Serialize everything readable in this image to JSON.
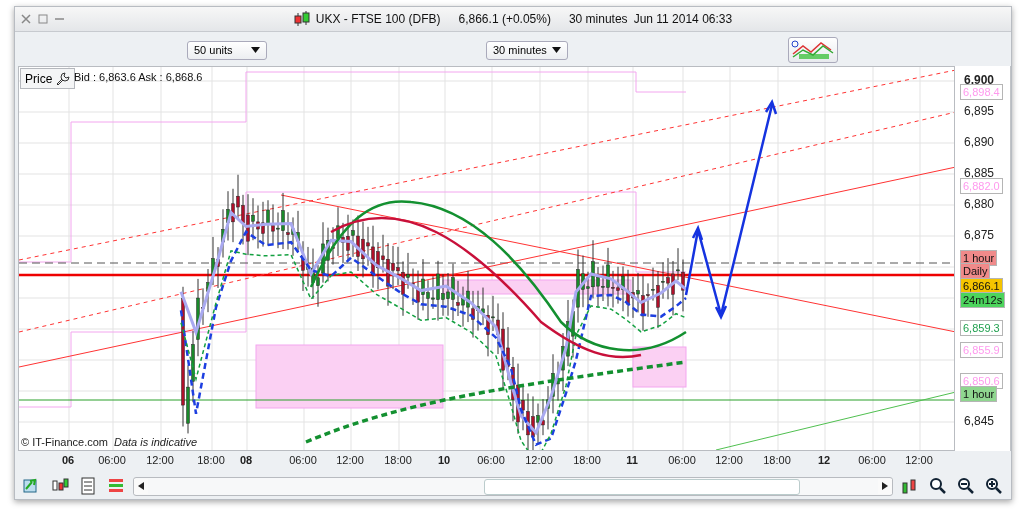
{
  "window": {
    "title": "UKX - FTSE 100 (DFB)",
    "quote": "6,866.1 (+0.05%)",
    "interval": "30 minutes",
    "timestamp": "Jun 11 2014 06:33"
  },
  "toolbar": {
    "size_select": "50 units",
    "interval_select": "30 minutes"
  },
  "chart": {
    "price_button": "Price",
    "bid_ask": "Bid : 6,863.6 Ask : 6,868.6",
    "copyright": "© IT-Finance.com",
    "disclaimer": "Data is indicative",
    "y_ticks": [
      {
        "label": "6,900",
        "major": true
      },
      {
        "label": "6,895",
        "major": false
      },
      {
        "label": "6,890",
        "major": false
      },
      {
        "label": "6,885",
        "major": false
      },
      {
        "label": "6,880",
        "major": false
      },
      {
        "label": "6,875",
        "major": false
      },
      {
        "label": "6,845",
        "major": false
      }
    ],
    "price_tags": [
      {
        "text": "6,898.4",
        "kind": "outlined",
        "color": "#ff99ee"
      },
      {
        "text": "6,882.0",
        "kind": "outlined",
        "color": "#ff99ee"
      },
      {
        "text": "1 hour",
        "kind": "filled",
        "color": "#f08a8a"
      },
      {
        "text": "Daily",
        "kind": "filled",
        "color": "#f08a8a"
      },
      {
        "text": "6,866.1",
        "kind": "filled",
        "color": "#f5c400"
      },
      {
        "text": "24m12s",
        "kind": "filled",
        "color": "#4cd45c"
      },
      {
        "text": "6,859.3",
        "kind": "outlined",
        "color": "#22a050"
      },
      {
        "text": "6,855.9",
        "kind": "outlined",
        "color": "#ff99ee"
      },
      {
        "text": "6,850.6",
        "kind": "outlined",
        "color": "#ff99ee"
      },
      {
        "text": "1 hour",
        "kind": "filled",
        "color": "#8fd68f"
      }
    ],
    "x_ticks": [
      {
        "label": "06",
        "day": true
      },
      {
        "label": "06:00",
        "day": false
      },
      {
        "label": "12:00",
        "day": false
      },
      {
        "label": "18:00",
        "day": false
      },
      {
        "label": "08",
        "day": true
      },
      {
        "label": "06:00",
        "day": false
      },
      {
        "label": "12:00",
        "day": false
      },
      {
        "label": "18:00",
        "day": false
      },
      {
        "label": "10",
        "day": true
      },
      {
        "label": "06:00",
        "day": false
      },
      {
        "label": "12:00",
        "day": false
      },
      {
        "label": "18:00",
        "day": false
      },
      {
        "label": "11",
        "day": true
      },
      {
        "label": "06:00",
        "day": false
      },
      {
        "label": "12:00",
        "day": false
      },
      {
        "label": "18:00",
        "day": false
      },
      {
        "label": "12",
        "day": true
      },
      {
        "label": "06:00",
        "day": false
      },
      {
        "label": "12:00",
        "day": false
      }
    ]
  }
}
